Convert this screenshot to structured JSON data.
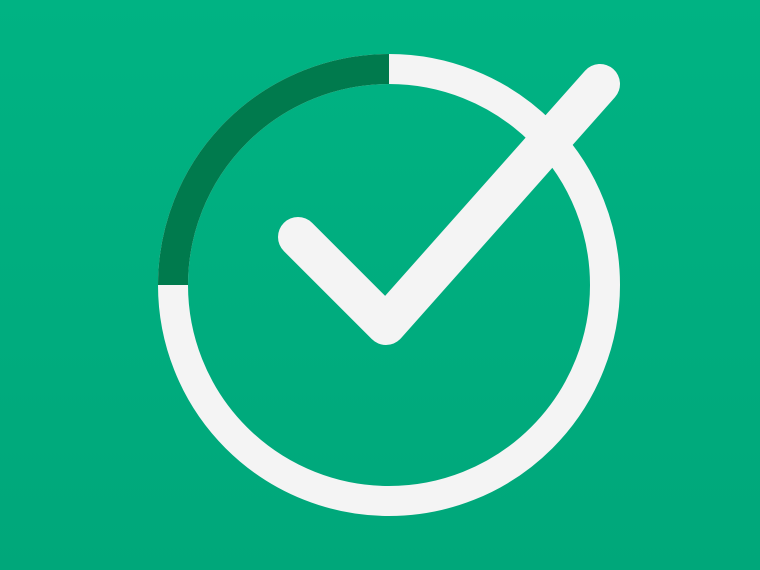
{
  "graphic": {
    "icon_name": "checkmark-in-circle-icon",
    "colors": {
      "background_top": "#00b383",
      "background_bottom": "#00a77a",
      "ring": "#f4f4f4",
      "ring_progress": "#007a4d",
      "checkmark": "#f4f4f4"
    },
    "progress_fraction": 0.25
  }
}
